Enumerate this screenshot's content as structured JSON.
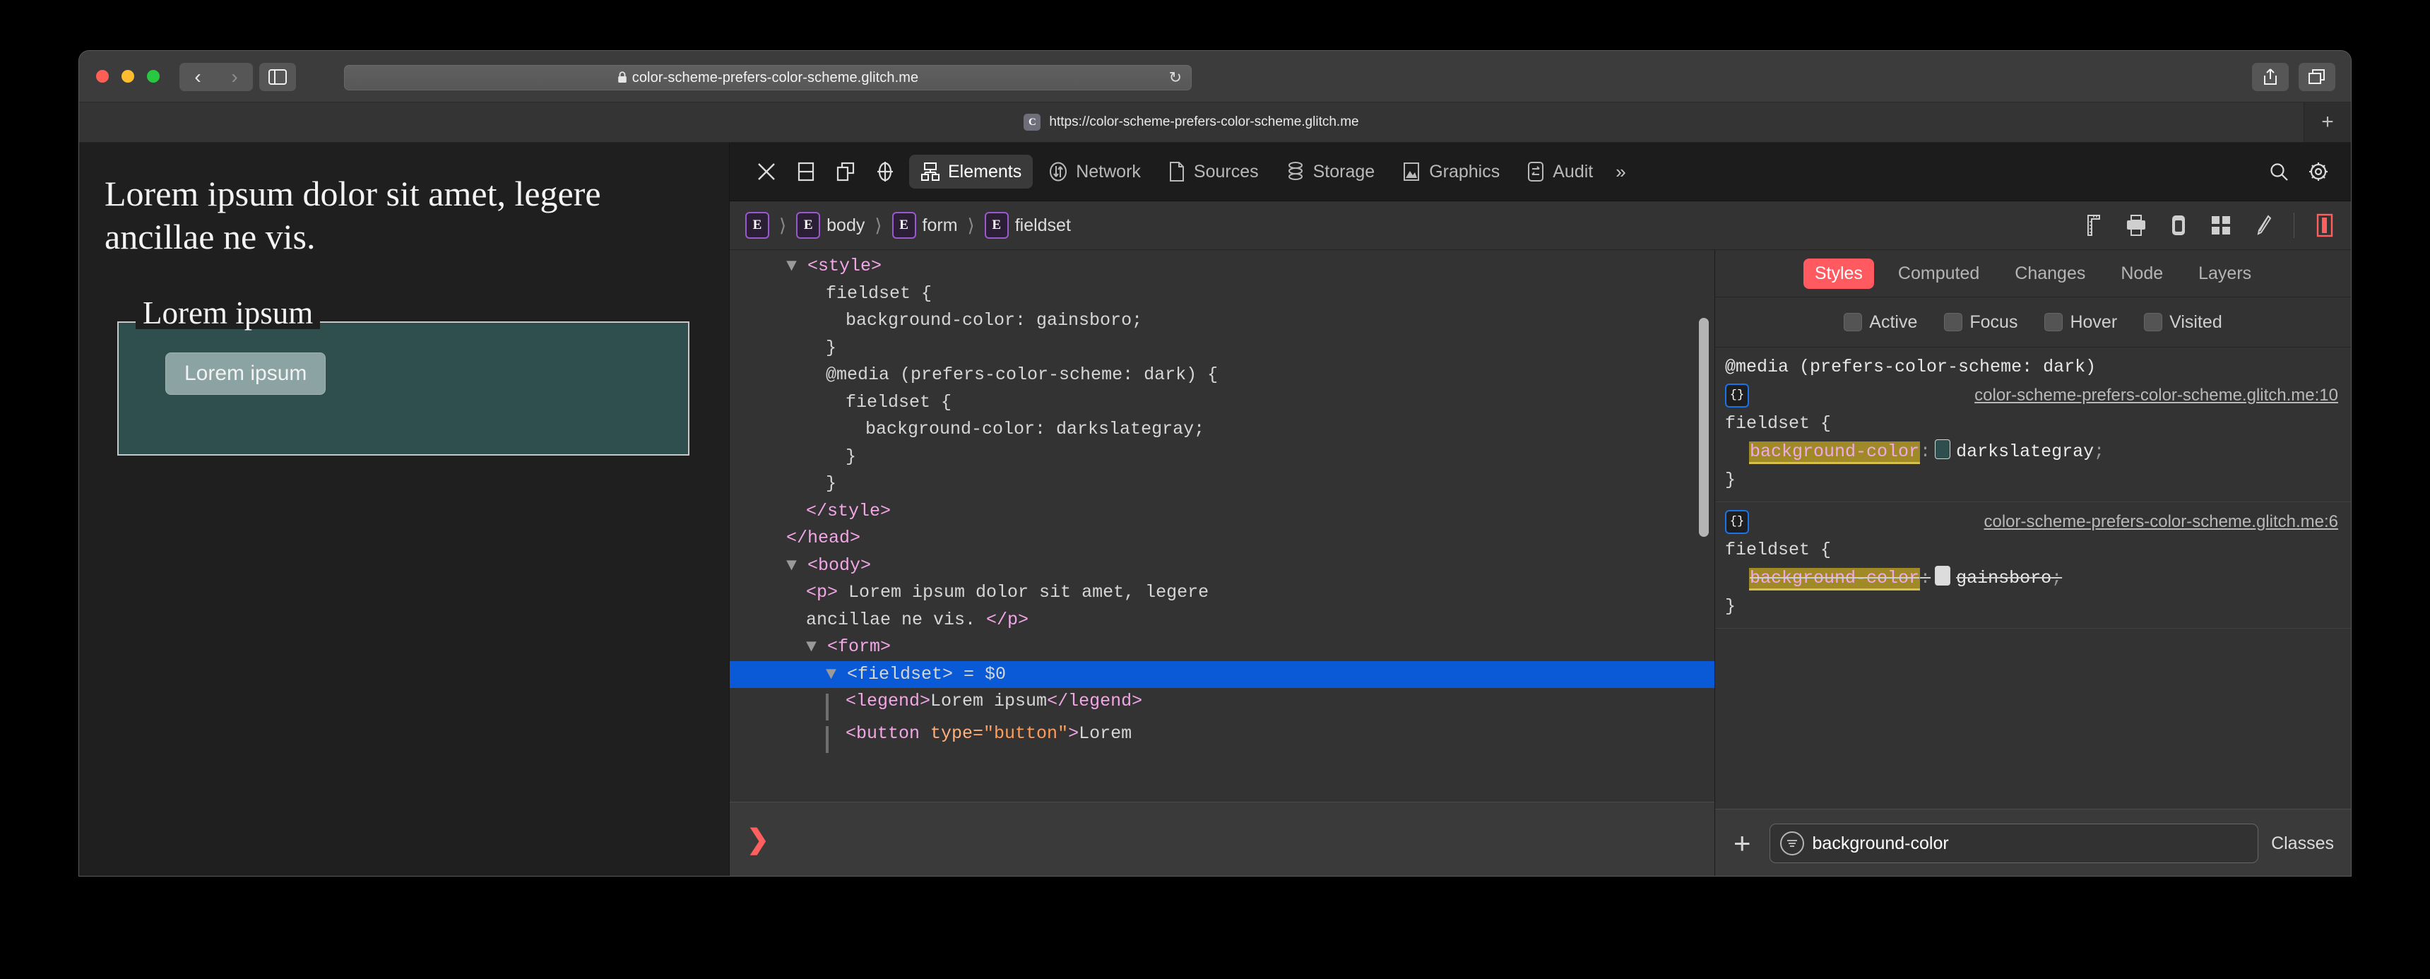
{
  "browser": {
    "url_display": "color-scheme-prefers-color-scheme.glitch.me",
    "lock_icon": "lock-icon",
    "reload_icon": "reload-icon",
    "back_icon": "chevron-left-icon",
    "forward_icon": "chevron-right-icon",
    "sidebar_icon": "sidebar-toggle-icon",
    "share_icon": "share-icon",
    "tabs_icon": "show-tabs-icon",
    "tab": {
      "favicon_letter": "C",
      "title": "https://color-scheme-prefers-color-scheme.glitch.me"
    },
    "new_tab_label": "+"
  },
  "page": {
    "paragraph": "Lorem ipsum dolor sit amet, legere ancillae ne vis.",
    "legend": "Lorem ipsum",
    "button_label": "Lorem ipsum",
    "fieldset_bg": "#2f4f4f",
    "page_bg": "#1f1f1f"
  },
  "devtools": {
    "toolbar_icons": [
      {
        "name": "close-devtools-icon"
      },
      {
        "name": "dock-bottom-icon"
      },
      {
        "name": "dock-side-icon"
      },
      {
        "name": "inspect-element-icon"
      }
    ],
    "tabs": [
      {
        "label": "Elements",
        "icon": "elements-tree-icon",
        "active": true
      },
      {
        "label": "Network",
        "icon": "network-arrows-icon",
        "active": false
      },
      {
        "label": "Sources",
        "icon": "document-icon",
        "active": false
      },
      {
        "label": "Storage",
        "icon": "database-icon",
        "active": false
      },
      {
        "label": "Graphics",
        "icon": "image-icon",
        "active": false
      },
      {
        "label": "Audit",
        "icon": "audit-swap-icon",
        "active": false
      }
    ],
    "overflow_label": "»",
    "search_icon": "search-icon",
    "settings_icon": "gear-icon",
    "breadcrumb": [
      {
        "badge": "E",
        "label": ""
      },
      {
        "badge": "E",
        "label": "body"
      },
      {
        "badge": "E",
        "label": "form"
      },
      {
        "badge": "E",
        "label": "fieldset"
      }
    ],
    "breadcrumb_tools": [
      {
        "name": "ruler-icon"
      },
      {
        "name": "print-icon"
      },
      {
        "name": "device-icon"
      },
      {
        "name": "grid-icon"
      },
      {
        "name": "paintbrush-icon"
      },
      {
        "name": "layout-highlight-icon"
      }
    ],
    "console_prompt": "❯"
  },
  "dom_tree": [
    {
      "indent": 2,
      "triangle": true,
      "parts": [
        {
          "t": "tag",
          "v": "<style>"
        }
      ]
    },
    {
      "indent": 4,
      "triangle": false,
      "parts": [
        {
          "t": "txt",
          "v": "fieldset {"
        }
      ]
    },
    {
      "indent": 5,
      "triangle": false,
      "parts": [
        {
          "t": "txt",
          "v": "background-color: gainsboro;"
        }
      ]
    },
    {
      "indent": 4,
      "triangle": false,
      "parts": [
        {
          "t": "txt",
          "v": "}"
        }
      ]
    },
    {
      "indent": 4,
      "triangle": false,
      "parts": [
        {
          "t": "txt",
          "v": "@media (prefers-color-scheme: dark) {"
        }
      ]
    },
    {
      "indent": 5,
      "triangle": false,
      "parts": [
        {
          "t": "txt",
          "v": "fieldset {"
        }
      ]
    },
    {
      "indent": 6,
      "triangle": false,
      "parts": [
        {
          "t": "txt",
          "v": "background-color: darkslategray;"
        }
      ]
    },
    {
      "indent": 5,
      "triangle": false,
      "parts": [
        {
          "t": "txt",
          "v": "}"
        }
      ]
    },
    {
      "indent": 4,
      "triangle": false,
      "parts": [
        {
          "t": "txt",
          "v": "}"
        }
      ]
    },
    {
      "indent": 3,
      "triangle": false,
      "parts": [
        {
          "t": "tag",
          "v": "</style>"
        }
      ]
    },
    {
      "indent": 2,
      "triangle": false,
      "parts": [
        {
          "t": "tag",
          "v": "</head>"
        }
      ]
    },
    {
      "indent": 2,
      "triangle": true,
      "parts": [
        {
          "t": "tag",
          "v": "<body>"
        }
      ]
    },
    {
      "indent": 3,
      "triangle": false,
      "parts": [
        {
          "t": "tag",
          "v": "<p>"
        },
        {
          "t": "txt",
          "v": " Lorem ipsum dolor sit amet, legere"
        }
      ]
    },
    {
      "indent": 3,
      "triangle": false,
      "parts": [
        {
          "t": "txt",
          "v": "ancillae ne vis. "
        },
        {
          "t": "tag",
          "v": "</p>"
        }
      ]
    },
    {
      "indent": 3,
      "triangle": true,
      "parts": [
        {
          "t": "tag",
          "v": "<form>"
        }
      ]
    },
    {
      "indent": 4,
      "triangle": true,
      "selected": true,
      "parts": [
        {
          "t": "txt",
          "v": "<fieldset> = $0"
        }
      ]
    },
    {
      "indent": 5,
      "guide": true,
      "triangle": false,
      "parts": [
        {
          "t": "tag",
          "v": "<legend>"
        },
        {
          "t": "txt",
          "v": "Lorem ipsum"
        },
        {
          "t": "tag",
          "v": "</legend>"
        }
      ]
    },
    {
      "indent": 5,
      "guide": true,
      "triangle": false,
      "parts": [
        {
          "t": "tag",
          "v": "<button "
        },
        {
          "t": "attrn",
          "v": "type="
        },
        {
          "t": "attrv",
          "v": "\"button\""
        },
        {
          "t": "tag",
          "v": ">"
        },
        {
          "t": "txt",
          "v": "Lorem"
        }
      ]
    }
  ],
  "styles_panel": {
    "tabs": [
      {
        "label": "Styles",
        "active": true
      },
      {
        "label": "Computed",
        "active": false
      },
      {
        "label": "Changes",
        "active": false
      },
      {
        "label": "Node",
        "active": false
      },
      {
        "label": "Layers",
        "active": false
      }
    ],
    "states": [
      "Active",
      "Focus",
      "Hover",
      "Visited"
    ],
    "rules": [
      {
        "media": "@media (prefers-color-scheme: dark)",
        "source": "color-scheme-prefers-color-scheme.glitch.me:10",
        "selector": "fieldset {",
        "close": "}",
        "declarations": [
          {
            "property": "background-color",
            "value": "darkslategray",
            "swatch": "#2f4f4f",
            "overridden": false
          }
        ]
      },
      {
        "media": "",
        "source": "color-scheme-prefers-color-scheme.glitch.me:6",
        "selector": "fieldset {",
        "close": "}",
        "declarations": [
          {
            "property": "background-color",
            "value": "gainsboro",
            "swatch": "#dcdcdc",
            "overridden": true
          }
        ]
      }
    ],
    "add_rule_label": "+",
    "filter_value": "background-color",
    "filter_icon": "filter-icon",
    "classes_label": "Classes"
  }
}
